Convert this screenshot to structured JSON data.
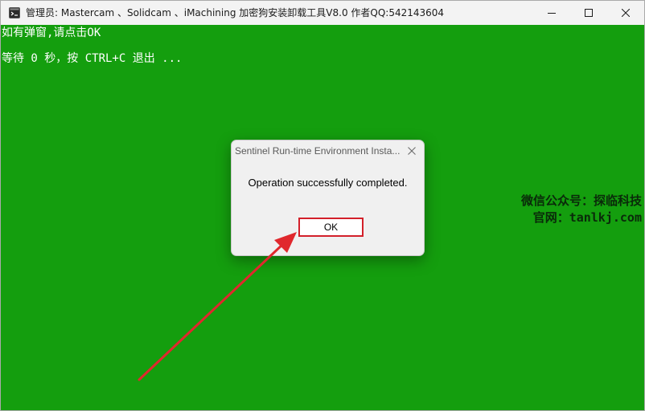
{
  "window": {
    "title": "管理员:  Mastercam 、Solidcam 、iMachining 加密狗安装卸载工具V8.0  作者QQ:542143604",
    "background_color": "#149e0e"
  },
  "console": {
    "lines": [
      "如有弹窗,请点击OK",
      "等待 0 秒，按 CTRL+C 退出 ..."
    ]
  },
  "watermark": {
    "line1": "微信公众号：探临科技",
    "line2": "官网：tanlkj.com"
  },
  "dialog": {
    "title": "Sentinel Run-time Environment Insta...",
    "message": "Operation successfully completed.",
    "ok_label": "OK",
    "highlight_color": "#d3202a"
  },
  "icons": {
    "app": "console-icon",
    "minimize": "minimize-icon",
    "maximize": "maximize-icon",
    "close": "close-icon",
    "dialog_close": "close-icon",
    "annotation": "arrow-icon"
  }
}
